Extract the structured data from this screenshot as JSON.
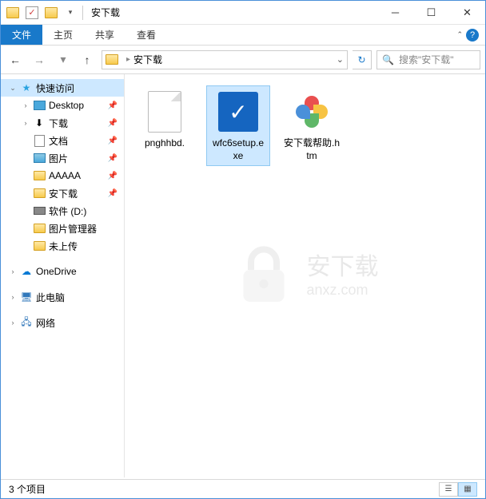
{
  "title": "安下载",
  "ribbon": {
    "file": "文件",
    "home": "主页",
    "share": "共享",
    "view": "查看"
  },
  "nav": {
    "breadcrumb": "安下载",
    "search_placeholder": "搜索\"安下载\""
  },
  "sidebar": {
    "quick_access": "快速访问",
    "items": [
      {
        "label": "Desktop",
        "icon": "desktop",
        "pinned": true
      },
      {
        "label": "下载",
        "icon": "download",
        "pinned": true
      },
      {
        "label": "文档",
        "icon": "doc",
        "pinned": true
      },
      {
        "label": "图片",
        "icon": "pic",
        "pinned": true
      },
      {
        "label": "AAAAA",
        "icon": "folder",
        "pinned": true
      },
      {
        "label": "安下载",
        "icon": "folder",
        "pinned": true
      },
      {
        "label": "软件 (D:)",
        "icon": "drive",
        "pinned": false
      },
      {
        "label": "图片管理器",
        "icon": "folder",
        "pinned": false
      },
      {
        "label": "未上传",
        "icon": "folder",
        "pinned": false
      }
    ],
    "onedrive": "OneDrive",
    "this_pc": "此电脑",
    "network": "网络"
  },
  "files": [
    {
      "name": "pnghhbd.",
      "type": "blank",
      "selected": false
    },
    {
      "name": "wfc6setup.exe",
      "type": "exe",
      "selected": true
    },
    {
      "name": "安下载帮助.htm",
      "type": "htm",
      "selected": false
    }
  ],
  "status": {
    "count": "3 个项目"
  },
  "watermark": {
    "text1": "安下载",
    "text2": "anxz.com"
  }
}
